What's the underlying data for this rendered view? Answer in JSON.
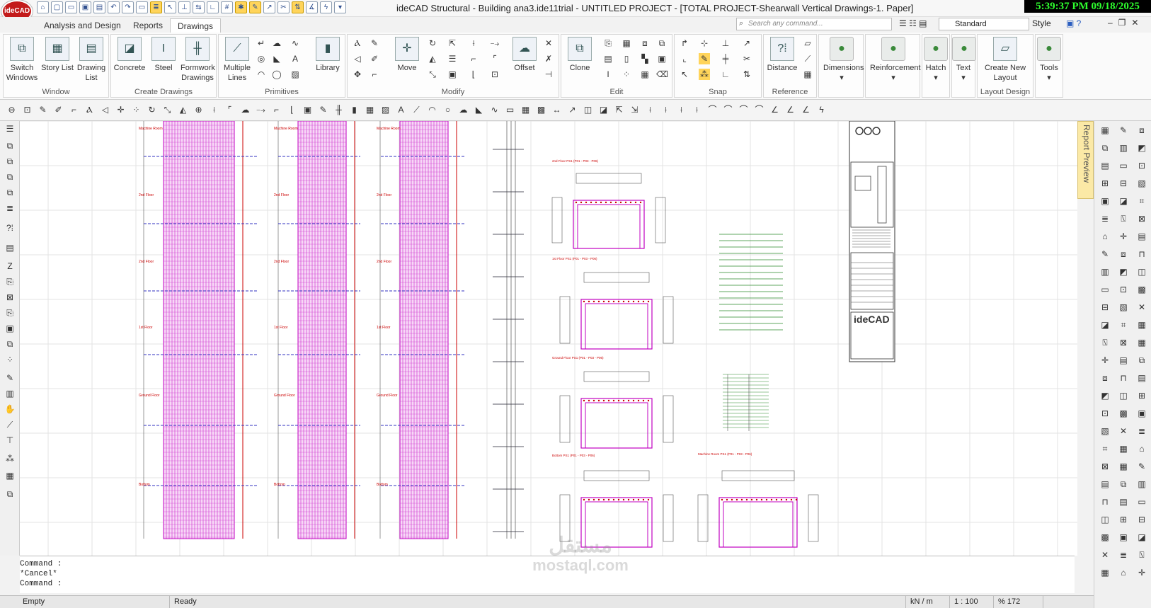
{
  "app": {
    "logo": "ideCAD",
    "title": "ideCAD Structural - Building ana3.ide11trial - UNTITLED PROJECT - [TOTAL PROJECT-Shearwall Vertical Drawings-1. Paper]",
    "clock": "5:39:37 PM 09/18/2025"
  },
  "tabs": [
    "Analysis and Design",
    "Reports",
    "Drawings"
  ],
  "search": {
    "placeholder": "Search any command..."
  },
  "standard": "Standard",
  "style": "Style",
  "ribbon": {
    "groups": [
      {
        "label": "Window",
        "buttons": [
          "Switch Windows",
          "Story List",
          "Drawing List"
        ]
      },
      {
        "label": "Create Drawings",
        "buttons": [
          "Concrete",
          "Steel",
          "Formwork Drawings"
        ]
      },
      {
        "label": "Primitives",
        "buttons": [
          "Multiple Lines",
          "Library"
        ]
      },
      {
        "label": "Modify",
        "buttons": [
          "Move",
          "Offset"
        ]
      },
      {
        "label": "Edit",
        "buttons": [
          "Clone"
        ]
      },
      {
        "label": "Snap",
        "buttons": []
      },
      {
        "label": "Reference",
        "buttons": [
          "Distance"
        ]
      },
      {
        "label": "",
        "buttons": [
          "Dimensions"
        ]
      },
      {
        "label": "",
        "buttons": [
          "Reinforcement"
        ]
      },
      {
        "label": "",
        "buttons": [
          "Hatch"
        ]
      },
      {
        "label": "",
        "buttons": [
          "Text"
        ]
      },
      {
        "label": "Layout Design",
        "buttons": [
          "Create New Layout"
        ]
      },
      {
        "label": "",
        "buttons": [
          "Tools"
        ]
      }
    ]
  },
  "report_preview": "Report Preview",
  "drawing": {
    "floors": [
      "Machine Room",
      "2nd Floor",
      "2nd Floor",
      "1st Floor",
      "Ground Floor",
      "Bottom"
    ],
    "sections": [
      "2nd Floor PS1 (P01 - P03 - P06)",
      "1st Floor PS1 (P01 - P03 - P06)",
      "Ground Floor PS1 (P01 - P03 - P06)",
      "Bottom PS1 (P01 - P03 - P06)",
      "Machine Room PS1 (P01 - P03 - P06)"
    ],
    "title_block_logo": "ideCAD"
  },
  "command": {
    "lines": [
      "Command :",
      "*Cancel*",
      "Command :"
    ]
  },
  "status": {
    "left": "Empty",
    "state": "Ready",
    "units": "kN / m",
    "scale": "1 : 100",
    "zoom": "% 172"
  },
  "watermark": {
    "top": "مستقل",
    "bottom": "mostaql.com"
  }
}
